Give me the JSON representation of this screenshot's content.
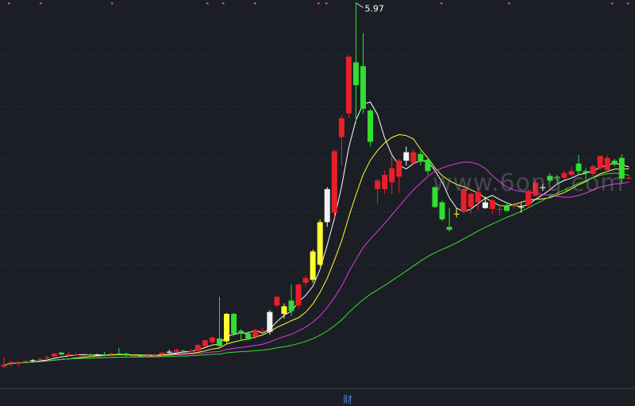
{
  "chart_data": {
    "type": "candlestick",
    "title": "",
    "peak_label": "5.97",
    "peak_high": 5.97,
    "ylim": [
      2.05,
      6.0
    ],
    "grid": "horizontal dotted",
    "series": [
      {
        "name": "",
        "color": "#ffffff",
        "kind": "moving-average"
      },
      {
        "name": "",
        "color": "#ffff33",
        "kind": "moving-average"
      },
      {
        "name": "",
        "color": "#e03be0",
        "kind": "moving-average"
      },
      {
        "name": "",
        "color": "#33e033",
        "kind": "moving-average"
      }
    ],
    "candles": [
      [
        2.12,
        2.14,
        2.11,
        2.22
      ],
      [
        2.16,
        2.17,
        2.12,
        2.18
      ],
      [
        2.17,
        2.17,
        2.12,
        2.18
      ],
      [
        2.17,
        2.18,
        2.15,
        2.19
      ],
      [
        2.18,
        2.19,
        2.17,
        2.2
      ],
      [
        2.19,
        2.2,
        2.18,
        2.22
      ],
      [
        2.21,
        2.22,
        2.19,
        2.24
      ],
      [
        2.23,
        2.26,
        2.22,
        2.27
      ],
      [
        2.27,
        2.25,
        2.24,
        2.28
      ],
      [
        2.24,
        2.25,
        2.23,
        2.28
      ],
      [
        2.25,
        2.25,
        2.23,
        2.27
      ],
      [
        2.24,
        2.24,
        2.23,
        2.25
      ],
      [
        2.25,
        2.24,
        2.23,
        2.26
      ],
      [
        2.24,
        2.25,
        2.23,
        2.26
      ],
      [
        2.25,
        2.24,
        2.23,
        2.28
      ],
      [
        2.25,
        2.26,
        2.24,
        2.27
      ],
      [
        2.26,
        2.25,
        2.24,
        2.32
      ],
      [
        2.26,
        2.24,
        2.23,
        2.27
      ],
      [
        2.24,
        2.24,
        2.23,
        2.25
      ],
      [
        2.24,
        2.23,
        2.23,
        2.25
      ],
      [
        2.24,
        2.24,
        2.23,
        2.26
      ],
      [
        2.24,
        2.25,
        2.23,
        2.26
      ],
      [
        2.25,
        2.27,
        2.24,
        2.28
      ],
      [
        2.27,
        2.28,
        2.26,
        2.3
      ],
      [
        2.28,
        2.3,
        2.27,
        2.31
      ],
      [
        2.29,
        2.28,
        2.27,
        2.3
      ],
      [
        2.28,
        2.29,
        2.27,
        2.31
      ],
      [
        2.29,
        2.35,
        2.28,
        2.36
      ],
      [
        2.34,
        2.4,
        2.33,
        2.41
      ],
      [
        2.38,
        2.43,
        2.36,
        2.44
      ],
      [
        2.42,
        2.34,
        2.33,
        2.86
      ],
      [
        2.39,
        2.68,
        2.37,
        2.69
      ],
      [
        2.68,
        2.47,
        2.44,
        2.69
      ],
      [
        2.5,
        2.47,
        2.4,
        2.52
      ],
      [
        2.47,
        2.42,
        2.4,
        2.5
      ],
      [
        2.44,
        2.51,
        2.41,
        2.52
      ],
      [
        2.5,
        2.5,
        2.47,
        2.53
      ],
      [
        2.49,
        2.7,
        2.46,
        2.72
      ],
      [
        2.77,
        2.86,
        2.75,
        2.87
      ],
      [
        2.68,
        2.76,
        2.63,
        2.79
      ],
      [
        2.82,
        2.71,
        2.66,
        2.99
      ],
      [
        2.77,
        2.99,
        2.74,
        3.0
      ],
      [
        3.01,
        3.06,
        2.97,
        3.09
      ],
      [
        3.04,
        3.34,
        3.01,
        3.36
      ],
      [
        3.2,
        3.65,
        3.18,
        3.68
      ],
      [
        3.65,
        4.0,
        3.6,
        4.02
      ],
      [
        3.75,
        4.4,
        3.7,
        4.42
      ],
      [
        4.55,
        4.75,
        4.25,
        4.78
      ],
      [
        4.8,
        5.4,
        4.75,
        5.42
      ],
      [
        5.34,
        5.1,
        4.7,
        5.97
      ],
      [
        5.3,
        4.85,
        4.8,
        5.65
      ],
      [
        4.83,
        4.5,
        4.45,
        4.85
      ],
      [
        4.0,
        4.09,
        3.85,
        4.11
      ],
      [
        4.0,
        4.15,
        3.95,
        4.2
      ],
      [
        4.07,
        4.22,
        3.95,
        4.35
      ],
      [
        4.13,
        4.3,
        3.96,
        4.32
      ],
      [
        4.39,
        4.3,
        4.25,
        4.45
      ],
      [
        4.28,
        4.39,
        4.25,
        4.42
      ],
      [
        4.37,
        4.29,
        4.25,
        4.4
      ],
      [
        4.31,
        4.19,
        4.15,
        4.34
      ],
      [
        4.02,
        3.81,
        3.8,
        4.03
      ],
      [
        3.86,
        3.68,
        3.66,
        3.88
      ],
      [
        3.6,
        3.57,
        3.55,
        3.8
      ],
      [
        3.74,
        3.74,
        3.7,
        3.8
      ],
      [
        3.76,
        4.0,
        3.74,
        4.02
      ],
      [
        3.81,
        3.95,
        3.74,
        3.96
      ],
      [
        3.86,
        3.97,
        3.77,
        4.02
      ],
      [
        3.8,
        3.86,
        3.79,
        3.92
      ],
      [
        3.79,
        3.88,
        3.74,
        3.9
      ],
      [
        3.79,
        3.79,
        3.72,
        3.84
      ],
      [
        3.82,
        3.77,
        3.76,
        3.86
      ],
      [
        3.82,
        3.83,
        3.79,
        3.86
      ],
      [
        3.81,
        3.81,
        3.75,
        3.85
      ],
      [
        3.83,
        3.98,
        3.81,
        4.0
      ],
      [
        3.93,
        4.07,
        3.92,
        4.1
      ],
      [
        4.02,
        4.01,
        3.98,
        4.05
      ],
      [
        4.14,
        4.09,
        4.07,
        4.17
      ],
      [
        4.13,
        4.12,
        4.05,
        4.15
      ],
      [
        4.12,
        4.17,
        4.1,
        4.2
      ],
      [
        4.15,
        4.19,
        4.13,
        4.24
      ],
      [
        4.27,
        4.19,
        4.15,
        4.36
      ],
      [
        4.19,
        4.17,
        4.08,
        4.22
      ],
      [
        4.16,
        4.24,
        4.14,
        4.26
      ],
      [
        4.22,
        4.35,
        4.2,
        4.36
      ],
      [
        4.2,
        4.33,
        4.2,
        4.36
      ],
      [
        4.3,
        4.26,
        4.24,
        4.32
      ],
      [
        4.33,
        4.11,
        4.06,
        4.37
      ],
      [
        4.12,
        4.12,
        4.1,
        4.14
      ]
    ]
  },
  "watermark": "www.6ong.com",
  "footer": {
    "label": "财"
  }
}
